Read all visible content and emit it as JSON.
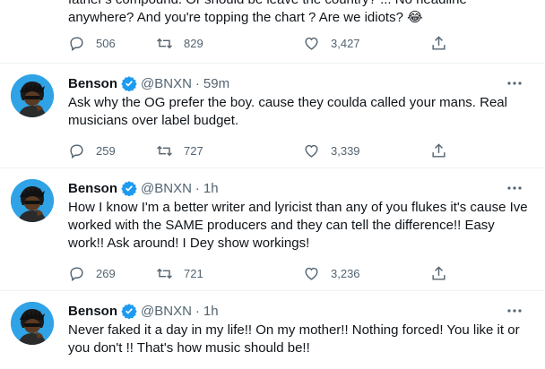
{
  "colors": {
    "accent": "#1d9bf0",
    "muted": "#536471",
    "text": "#0f1419",
    "avatar_bg": "#2fa3e6",
    "divider": "#eff3f4"
  },
  "tweets": [
    {
      "text": "father's compound. Or should be leave the country? ... No headline anywhere? And you're topping the chart ? Are we idiots? 😂",
      "replies": "506",
      "retweets": "829",
      "likes": "3,427"
    },
    {
      "name": "Benson",
      "handle": "@BNXN",
      "time": "59m",
      "text": "Ask why the OG prefer the boy. cause they coulda called your mans. Real musicians over label budget.",
      "replies": "259",
      "retweets": "727",
      "likes": "3,339"
    },
    {
      "name": "Benson",
      "handle": "@BNXN",
      "time": "1h",
      "text": "How I know I'm a better writer and lyricist than any of you flukes it's cause Ive worked with the SAME producers and they can tell the difference!! Easy work!! Ask around! I Dey show workings!",
      "replies": "269",
      "retweets": "721",
      "likes": "3,236"
    },
    {
      "name": "Benson",
      "handle": "@BNXN",
      "time": "1h",
      "text": "Never faked it a day in my life!! On my mother!! Nothing forced! You like it or you don't !! That's how music should be!!"
    }
  ],
  "icons": [
    "reply-icon",
    "retweet-icon",
    "like-icon",
    "share-icon",
    "verified-icon",
    "more-icon"
  ]
}
